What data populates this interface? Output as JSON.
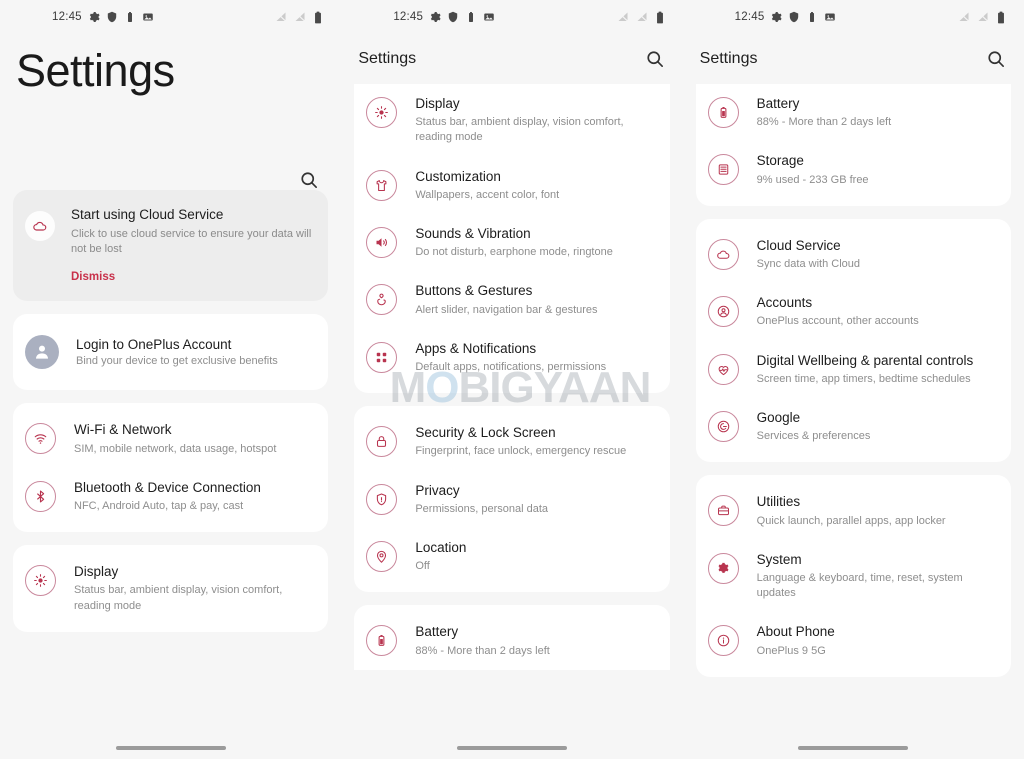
{
  "statusbar": {
    "time": "12:45",
    "left_icons": [
      "gear-icon",
      "shield-icon",
      "battery-saver-icon",
      "screenshot-icon"
    ],
    "right_icons": [
      "signal-off-icon",
      "signal-off-icon",
      "battery-icon"
    ]
  },
  "watermark": {
    "before": "M",
    "o": "O",
    "after": "BIGYAAN"
  },
  "screen1": {
    "title": "Settings",
    "search_icon": "search-icon",
    "promo": {
      "icon": "cloud-icon",
      "title": "Start using Cloud Service",
      "subtitle": "Click to use cloud service to ensure your data will not be lost",
      "dismiss": "Dismiss"
    },
    "login": {
      "icon": "person-icon",
      "title": "Login to OnePlus Account",
      "subtitle": "Bind your device to get exclusive benefits"
    },
    "groups": [
      {
        "items": [
          {
            "icon": "wifi-icon",
            "title": "Wi-Fi & Network",
            "subtitle": "SIM, mobile network, data usage, hotspot"
          },
          {
            "icon": "bluetooth-icon",
            "title": "Bluetooth & Device Connection",
            "subtitle": "NFC, Android Auto, tap & pay, cast"
          }
        ]
      },
      {
        "items": [
          {
            "icon": "display-icon",
            "title": "Display",
            "subtitle": "Status bar, ambient display, vision comfort, reading mode"
          }
        ]
      }
    ]
  },
  "screen2": {
    "title": "Settings",
    "search_icon": "search-icon",
    "groups": [
      {
        "items": [
          {
            "icon": "display-icon",
            "title": "Display",
            "subtitle": "Status bar, ambient display, vision comfort, reading mode"
          },
          {
            "icon": "customization-icon",
            "title": "Customization",
            "subtitle": "Wallpapers, accent color, font"
          },
          {
            "icon": "sound-icon",
            "title": "Sounds & Vibration",
            "subtitle": "Do not disturb, earphone mode, ringtone"
          },
          {
            "icon": "gestures-icon",
            "title": "Buttons & Gestures",
            "subtitle": "Alert slider, navigation bar & gestures"
          },
          {
            "icon": "apps-icon",
            "title": "Apps & Notifications",
            "subtitle": "Default apps, notifications, permissions"
          }
        ]
      },
      {
        "items": [
          {
            "icon": "lock-icon",
            "title": "Security & Lock Screen",
            "subtitle": "Fingerprint, face unlock, emergency rescue"
          },
          {
            "icon": "privacy-icon",
            "title": "Privacy",
            "subtitle": "Permissions, personal data"
          },
          {
            "icon": "location-icon",
            "title": "Location",
            "subtitle": "Off"
          }
        ]
      },
      {
        "items": [
          {
            "icon": "battery-icon",
            "title": "Battery",
            "subtitle": "88% - More than 2 days left"
          }
        ]
      }
    ]
  },
  "screen3": {
    "title": "Settings",
    "search_icon": "search-icon",
    "groups": [
      {
        "items": [
          {
            "icon": "battery-icon",
            "title": "Battery",
            "subtitle": "88% - More than 2 days left"
          },
          {
            "icon": "storage-icon",
            "title": "Storage",
            "subtitle": "9% used - 233 GB free"
          }
        ]
      },
      {
        "items": [
          {
            "icon": "cloud-icon",
            "title": "Cloud Service",
            "subtitle": "Sync data with Cloud"
          },
          {
            "icon": "accounts-icon",
            "title": "Accounts",
            "subtitle": "OnePlus account, other accounts"
          },
          {
            "icon": "wellbeing-icon",
            "title": "Digital Wellbeing & parental controls",
            "subtitle": "Screen time, app timers, bedtime schedules"
          },
          {
            "icon": "google-icon",
            "title": "Google",
            "subtitle": "Services & preferences"
          }
        ]
      },
      {
        "items": [
          {
            "icon": "utilities-icon",
            "title": "Utilities",
            "subtitle": "Quick launch, parallel apps, app locker"
          },
          {
            "icon": "system-icon",
            "title": "System",
            "subtitle": "Language & keyboard, time, reset, system updates"
          },
          {
            "icon": "info-icon",
            "title": "About Phone",
            "subtitle": "OnePlus 9 5G"
          }
        ]
      }
    ]
  },
  "colors": {
    "accent": "#b8344f",
    "icon_ring": "#c9889c",
    "card_bg": "#ffffff",
    "screen_bg": "#f6f6f6",
    "promo_bg": "#ededed",
    "title_text": "#1d1d1d",
    "sub_text": "#8e8e8e"
  }
}
